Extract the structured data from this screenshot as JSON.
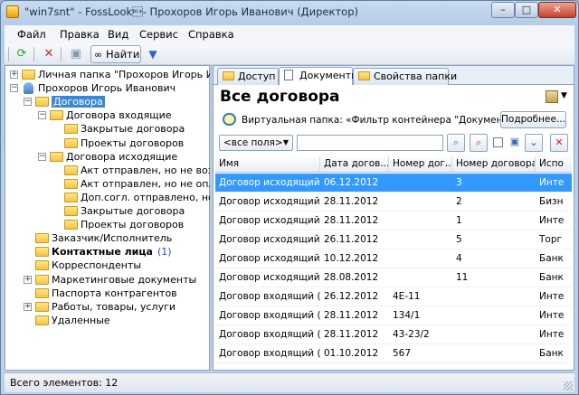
{
  "window": {
    "title": "\"win7snt\" - FossLook\u0014- Прохоров Игорь Иванович (Директор)",
    "min": "–",
    "max": "□",
    "close": "✕"
  },
  "menu": [
    "Файл",
    "Правка",
    "Вид",
    "Сервис",
    "Справка"
  ],
  "toolbar": {
    "find_label": "Найти",
    "icons": [
      "refresh-icon",
      "delete-icon",
      "save-icon",
      "binoculars-icon",
      "filter-icon"
    ]
  },
  "tree": [
    {
      "label": "Личная папка \"Прохоров Игорь Ивано",
      "level": 0,
      "icon": "folder",
      "expander": "+"
    },
    {
      "label": "Прохоров Игорь Иванович",
      "level": 0,
      "icon": "person",
      "expander": "−"
    },
    {
      "label": "Договора",
      "level": 1,
      "icon": "folder",
      "expander": "−",
      "selected": true
    },
    {
      "label": "Договора входящие",
      "level": 2,
      "icon": "folder",
      "expander": "−"
    },
    {
      "label": "Закрытые договора",
      "level": 3,
      "icon": "folder"
    },
    {
      "label": "Проекты договоров",
      "level": 3,
      "icon": "folder"
    },
    {
      "label": "Договора исходящие",
      "level": 2,
      "icon": "folder",
      "expander": "−"
    },
    {
      "label": "Акт отправлен, но не возвр",
      "level": 3,
      "icon": "folder"
    },
    {
      "label": "Акт отправлен, но не оплач",
      "level": 3,
      "icon": "folder"
    },
    {
      "label": "Доп.согл. отправлено, но не",
      "level": 3,
      "icon": "folder"
    },
    {
      "label": "Закрытые договора",
      "level": 3,
      "icon": "folder"
    },
    {
      "label": "Проекты договоров",
      "level": 3,
      "icon": "folder"
    },
    {
      "label": "Заказчик/Исполнитель",
      "level": 1,
      "icon": "folder"
    },
    {
      "label": "Контактные лица",
      "level": 1,
      "icon": "folder",
      "bold": true,
      "count": "(1)"
    },
    {
      "label": "Корреспонденты",
      "level": 1,
      "icon": "folder"
    },
    {
      "label": "Маркетинговые документы",
      "level": 1,
      "icon": "folder",
      "expander": "+"
    },
    {
      "label": "Паспорта контрагентов",
      "level": 1,
      "icon": "folder"
    },
    {
      "label": "Работы, товары, услуги",
      "level": 1,
      "icon": "folder",
      "expander": "+"
    },
    {
      "label": "Удаленные",
      "level": 1,
      "icon": "folder"
    }
  ],
  "tabs": [
    "Доступ",
    "Документы",
    "Свойства папки"
  ],
  "main": {
    "heading": "Все договора",
    "virtual_folder": "Виртуальная папка: «Фильтр контейнера \"Документы\"»",
    "more_button": "Подробнее...",
    "field_select": "<все поля>",
    "search_value": ""
  },
  "grid": {
    "columns": [
      "Имя",
      "Дата догов...",
      "Номер дог...",
      "Номер договора",
      "Испо"
    ],
    "rows": [
      [
        "Договор исходящий (...",
        "06.12.2012",
        "",
        "3",
        "Инте"
      ],
      [
        "Договор исходящий (...",
        "28.11.2012",
        "",
        "2",
        "Бизн"
      ],
      [
        "Договор исходящий (...",
        "28.11.2012",
        "",
        "1",
        "Инте"
      ],
      [
        "Договор исходящий (...",
        "26.11.2012",
        "",
        "5",
        "Торг"
      ],
      [
        "Договор исходящий (...",
        "10.12.2012",
        "",
        "4",
        "Банк"
      ],
      [
        "Договор исходящий (...",
        "28.08.2012",
        "",
        "11",
        "Банк"
      ],
      [
        "Договор входящий (...",
        "26.12.2012",
        "4Е-11",
        "",
        "Инте"
      ],
      [
        "Договор входящий (...",
        "28.11.2012",
        "134/1",
        "",
        "Инте"
      ],
      [
        "Договор входящий (...",
        "28.11.2012",
        "43-23/2",
        "",
        "Инте"
      ],
      [
        "Договор входящий (...",
        "01.10.2012",
        "567",
        "",
        "Банк"
      ]
    ],
    "selected_row": 0
  },
  "status": "Всего элементов: 12"
}
